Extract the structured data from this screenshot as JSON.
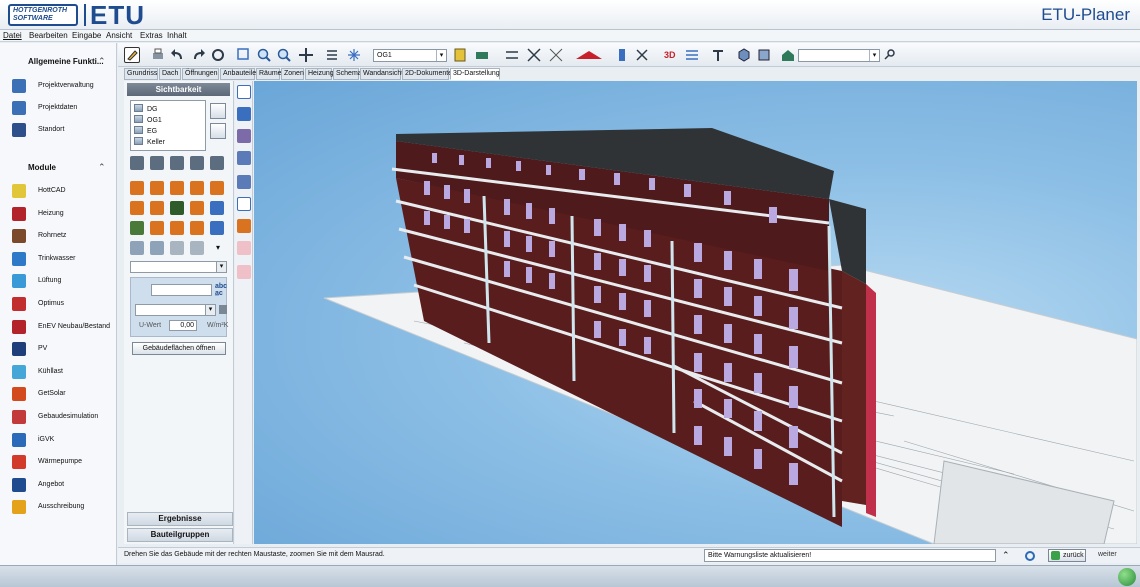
{
  "app": {
    "logo_line1": "HOTTGENROTH",
    "logo_line2": "SOFTWARE",
    "logo_product": "ETU",
    "title": "ETU-Planer"
  },
  "menu": [
    "Datei",
    "Bearbeiten",
    "Eingabe",
    "Ansicht",
    "Extras",
    "Inhalt"
  ],
  "sidebar": {
    "section1": "Allgemeine Funkti...",
    "general": [
      {
        "label": "Projektverwaltung",
        "icon": "project-icon",
        "color": "#3b6fb6"
      },
      {
        "label": "Projektdaten",
        "icon": "project-data-icon",
        "color": "#3b6fb6"
      },
      {
        "label": "Standort",
        "icon": "location-icon",
        "color": "#2d4f8a"
      }
    ],
    "section2": "Module",
    "modules": [
      {
        "label": "HottCAD",
        "icon": "hottcad-icon",
        "color": "#e2c63a"
      },
      {
        "label": "Heizung",
        "icon": "heating-icon",
        "color": "#b3242a"
      },
      {
        "label": "Rohrnetz",
        "icon": "pipe-network-icon",
        "color": "#7a4a2a"
      },
      {
        "label": "Trinkwasser",
        "icon": "drinking-water-icon",
        "color": "#2f7ac8"
      },
      {
        "label": "Lüftung",
        "icon": "ventilation-icon",
        "color": "#3a9ad8"
      },
      {
        "label": "Optimus",
        "icon": "optimus-icon",
        "color": "#c22e2e"
      },
      {
        "label": "EnEV Neubau/Bestand",
        "icon": "enev-icon",
        "color": "#b3242a"
      },
      {
        "label": "PV",
        "icon": "pv-icon",
        "color": "#1e3f7a"
      },
      {
        "label": "Kühllast",
        "icon": "cooling-load-icon",
        "color": "#45a7d8"
      },
      {
        "label": "GetSolar",
        "icon": "getsolar-icon",
        "color": "#d44a1f"
      },
      {
        "label": "Gebaudesimulation",
        "icon": "simulation-icon",
        "color": "#c23a3a"
      },
      {
        "label": "iGVK",
        "icon": "igvk-icon",
        "color": "#2a6ab8"
      },
      {
        "label": "Wärmepumpe",
        "icon": "heat-pump-icon",
        "color": "#d23a2a"
      },
      {
        "label": "Angebot",
        "icon": "offer-icon",
        "color": "#1e4c8f"
      },
      {
        "label": "Ausschreibung",
        "icon": "tender-icon",
        "color": "#e3a21a"
      }
    ]
  },
  "toolbar": {
    "floor_combo": "OG1",
    "search_value": ""
  },
  "tabs": [
    "Grundriss",
    "Dach",
    "Öffnungen",
    "Anbauteile",
    "Räume",
    "Zonen",
    "Heizung",
    "Schema",
    "Wandansicht",
    "2D-Dokumente",
    "3D-Darstellung"
  ],
  "panel": {
    "header": "Sichtbarkeit",
    "floors": [
      "DG",
      "OG1",
      "EG",
      "Keller"
    ],
    "uwert_label": "U-Wert",
    "uwert_value": "0,00",
    "uwert_unit": "W/m²K",
    "open_button": "Gebäudeflächen öffnen",
    "acc1": "Ergebnisse",
    "acc2": "Bauteilgruppen"
  },
  "status": {
    "message": "Drehen Sie das Gebäude mit der rechten Maustaste, zoomen Sie mit dem Mausrad.",
    "warning": "Bitte Warnungsliste aktualisieren!",
    "back": "zurück",
    "next": "weiter"
  },
  "colors": {
    "brand": "#1e4c8f",
    "brick": "#5a1d1e",
    "roof": "#2f3335",
    "sky": "#8ec0e6"
  }
}
